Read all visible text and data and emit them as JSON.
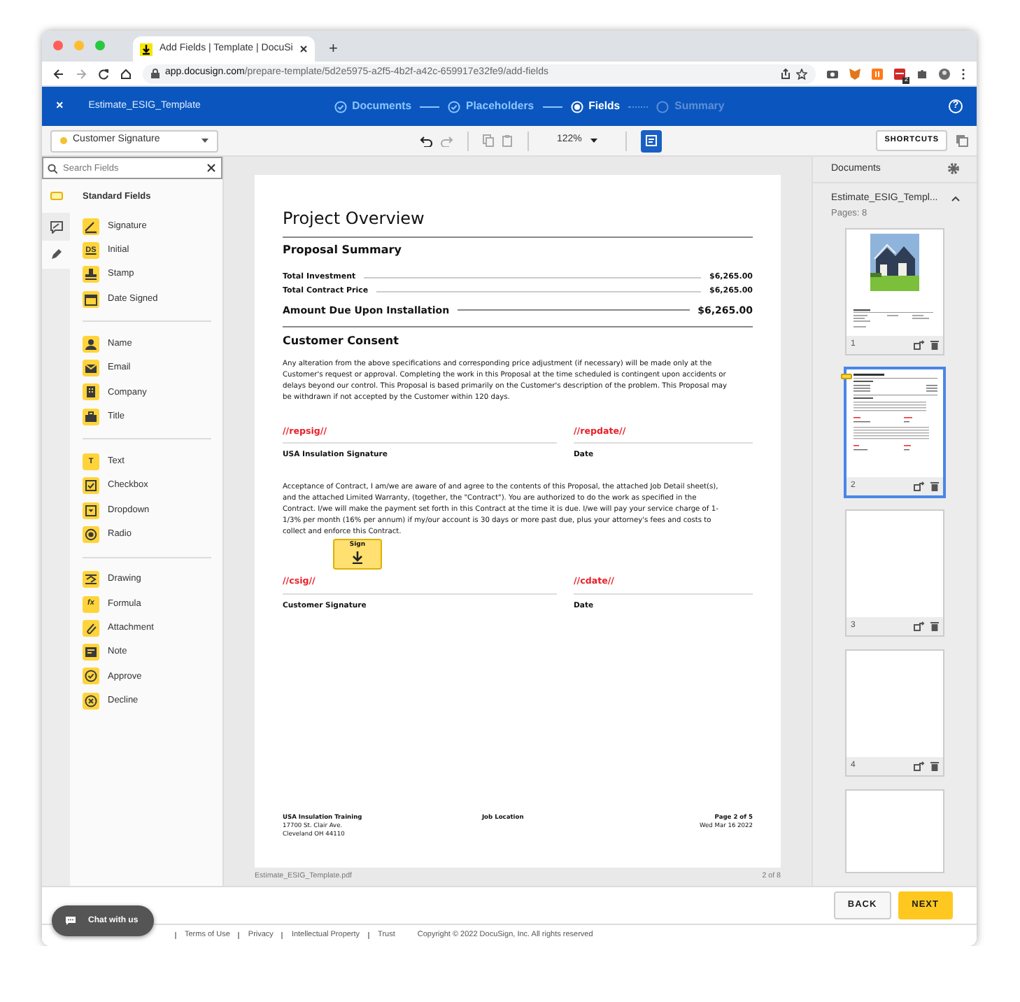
{
  "browser": {
    "tab_title": "Add Fields | Template | DocuSi",
    "new_tab": "+",
    "url_host": "app.docusign.com",
    "url_path": "/prepare-template/5d2e5975-a2f5-4b2f-a42c-659917e32fe9/add-fields",
    "ext_badge": "2"
  },
  "header": {
    "close": "×",
    "template_name": "Estimate_ESIG_Template",
    "help": "?",
    "steps": [
      {
        "label": "Documents",
        "completed": true,
        "selected": false
      },
      {
        "label": "Placeholders",
        "completed": true,
        "selected": false
      },
      {
        "label": "Fields",
        "completed": false,
        "selected": true
      },
      {
        "label": "Summary",
        "completed": false,
        "selected": false
      }
    ]
  },
  "toolbar": {
    "recipient": {
      "label": "Customer Signature",
      "color": "#f2c230"
    },
    "zoom": "122%",
    "shortcuts": "SHORTCUTS"
  },
  "fields_panel": {
    "search_placeholder": "Search Fields",
    "heading": "Standard Fields",
    "groups": [
      [
        {
          "label": "Signature"
        },
        {
          "label": "Initial",
          "icon_text": "DS"
        },
        {
          "label": "Stamp"
        },
        {
          "label": "Date Signed"
        }
      ],
      [
        {
          "label": "Name"
        },
        {
          "label": "Email"
        },
        {
          "label": "Company"
        },
        {
          "label": "Title"
        }
      ],
      [
        {
          "label": "Text",
          "icon_text": "T"
        },
        {
          "label": "Checkbox"
        },
        {
          "label": "Dropdown"
        },
        {
          "label": "Radio"
        }
      ],
      [
        {
          "label": "Drawing"
        },
        {
          "label": "Formula",
          "icon_text": "fx"
        },
        {
          "label": "Attachment"
        },
        {
          "label": "Note"
        },
        {
          "label": "Approve"
        },
        {
          "label": "Decline"
        }
      ]
    ]
  },
  "document": {
    "title": "Project Overview",
    "summary_heading": "Proposal Summary",
    "rows": [
      {
        "label": "Total Investment",
        "value": "$6,265.00",
        "kind": "normal"
      },
      {
        "label": "Total Contract Price",
        "value": "$6,265.00",
        "kind": "normal"
      },
      {
        "label": "Amount Due Upon Installation",
        "value": "$6,265.00",
        "kind": "total"
      }
    ],
    "consent_heading": "Customer Consent",
    "consent_text": "Any alteration from the above specifications and corresponding price adjustment (if necessary) will be made only at the Customer's request or approval. Completing the work in this Proposal at the time scheduled is contingent upon accidents or delays beyond our control. This Proposal is based primarily on the Customer's description of the problem. This Proposal may be withdrawn if not accepted by the Customer within 120 days.",
    "signature_blocks": [
      [
        {
          "tag": "//repsig//",
          "label": "USA Insulation Signature"
        },
        {
          "tag": "//repdate//",
          "label": "Date"
        }
      ],
      [
        {
          "tag": "//csig//",
          "label": "Customer Signature"
        },
        {
          "tag": "//cdate//",
          "label": "Date"
        }
      ]
    ],
    "acceptance_text": "Acceptance of Contract, I am/we are aware of and agree to the contents of this Proposal, the attached Job Detail sheet(s), and the attached Limited Warranty, (together, the \"Contract\"). You are authorized to do the work as specified in the Contract. I/we will make the payment set forth in this Contract at the time it is due. I/we will pay your service charge of 1-1/3% per month (16% per annum) if my/our account is 30 days or more past due, plus your attorney's fees and costs to collect and enforce this Contract.",
    "sign_tag": "Sign",
    "footer": {
      "company": "USA Insulation Training",
      "address": [
        "17700 St. Clair Ave.",
        "Cleveland OH 44110"
      ],
      "center": "Job Location",
      "page": "Page 2 of 5",
      "date": "Wed Mar 16 2022"
    },
    "filename": "Estimate_ESIG_Template.pdf",
    "page_of": "2 of 8"
  },
  "documents_panel": {
    "title": "Documents",
    "doc_name": "Estimate_ESIG_Templ...",
    "pages_label": "Pages: 8",
    "pages": [
      {
        "number": "1",
        "kind": "cover",
        "selected": false
      },
      {
        "number": "2",
        "kind": "document",
        "selected": true
      },
      {
        "number": "3",
        "kind": "blank",
        "selected": false
      },
      {
        "number": "4",
        "kind": "blank",
        "selected": false
      },
      {
        "kind": "blank",
        "selected": false
      }
    ]
  },
  "buttons": [
    {
      "label": "BACK",
      "kind": "secondary"
    },
    {
      "label": "NEXT",
      "kind": "primary"
    }
  ],
  "chat": "Chat with us",
  "footer_links": [
    "Terms of Use",
    "Privacy",
    "Intellectual Property",
    "Trust"
  ],
  "copyright": "Copyright © 2022 DocuSign, Inc. All rights reserved"
}
